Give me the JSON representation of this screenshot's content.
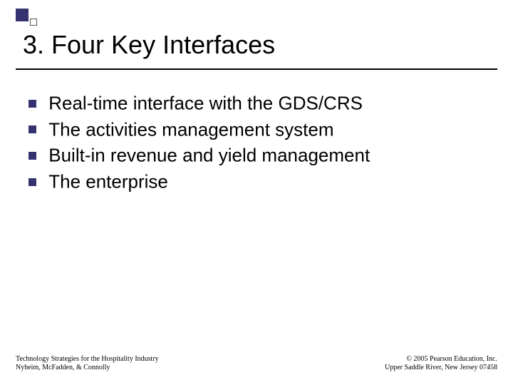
{
  "title": "3. Four Key Interfaces",
  "bullets": [
    "Real-time interface with the GDS/CRS",
    "The activities management system",
    "Built-in revenue and yield management",
    "The enterprise"
  ],
  "footer": {
    "left_line1": "Technology Strategies for the Hospitality Industry",
    "left_line2": "Nyheim, McFadden, & Connolly",
    "right_line1": "© 2005 Pearson Education, Inc.",
    "right_line2": "Upper Saddle River, New Jersey 07458"
  }
}
